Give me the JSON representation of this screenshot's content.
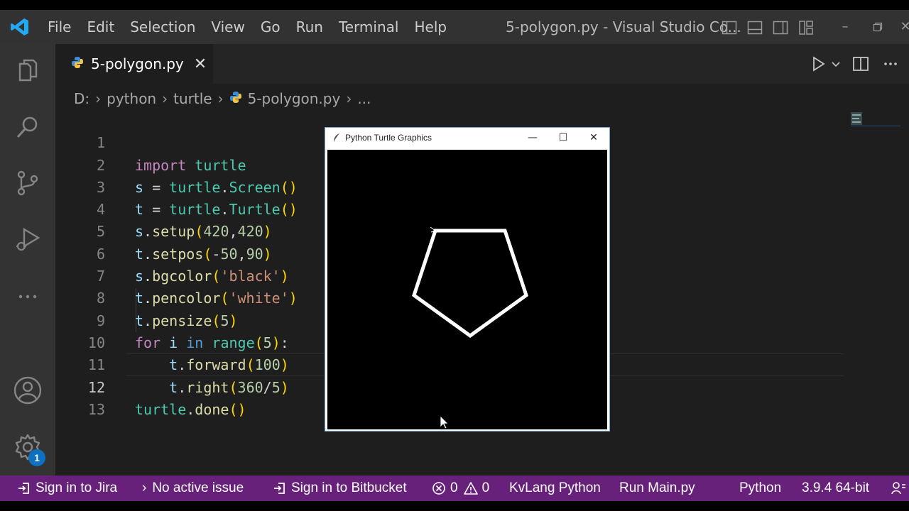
{
  "titlebar": {
    "menu": [
      "File",
      "Edit",
      "Selection",
      "View",
      "Go",
      "Run",
      "Terminal",
      "Help"
    ],
    "window_title": "5-polygon.py - Visual Studio Co..."
  },
  "activity_bar": {
    "icons": [
      "explorer-icon",
      "search-icon",
      "source-control-icon",
      "run-debug-icon",
      "more-icon",
      "accounts-icon",
      "settings-gear-icon"
    ],
    "settings_badge": "1"
  },
  "tab": {
    "label": "5-polygon.py",
    "close": "✕"
  },
  "breadcrumb": {
    "drive": "D:",
    "folder1": "python",
    "folder2": "turtle",
    "file": "5-polygon.py",
    "ellipsis": "..."
  },
  "code": {
    "line_numbers": [
      "1",
      "2",
      "3",
      "4",
      "5",
      "6",
      "7",
      "8",
      "9",
      "10",
      "11",
      "12",
      "13"
    ],
    "lines": [
      "import turtle",
      "s = turtle.Screen()",
      "t = turtle.Turtle()",
      "s.setup(420,420)",
      "t.setpos(-50,90)",
      "s.bgcolor('black')",
      "t.pencolor('white')",
      "t.pensize(5)",
      "for i in range(5):",
      "    t.forward(100)",
      "    t.right(360/5)",
      "turtle.done()",
      ""
    ],
    "active_line": "12"
  },
  "turtle_window": {
    "title": "Python Turtle Graphics",
    "minimize": "—",
    "maximize": "☐",
    "close": "✕",
    "background": "#000000",
    "pen_color": "#ffffff",
    "shape": "pentagon"
  },
  "statusbar": {
    "jira": "Sign in to Jira",
    "issue": "No active issue",
    "bitbucket": "Sign in to Bitbucket",
    "errors": "0",
    "warnings": "0",
    "kvlang": "KvLang Python",
    "run_main": "Run Main.py",
    "language": "Python",
    "interpreter": "3.9.4 64-bit",
    "color": "#68217a"
  }
}
